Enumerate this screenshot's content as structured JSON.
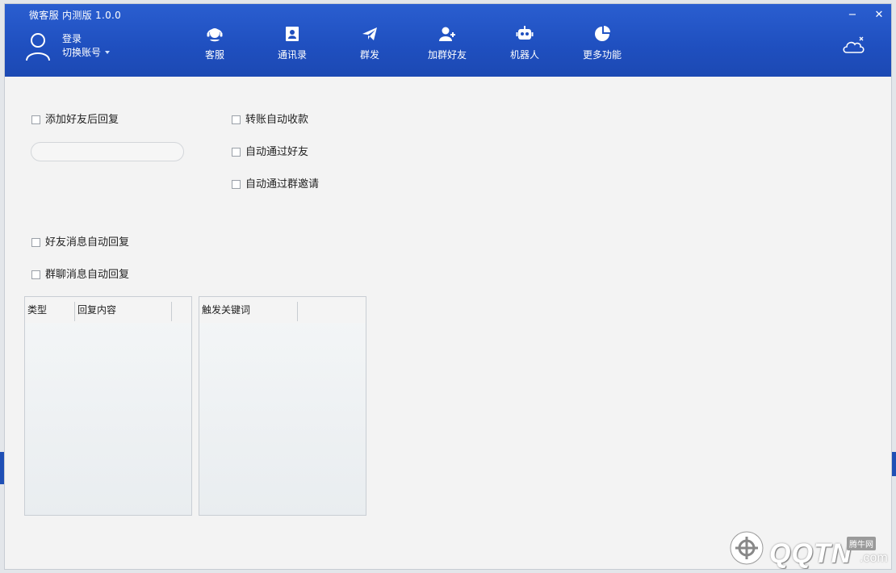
{
  "window": {
    "title": "微客服  内测版 1.0.0",
    "minimize_glyph": "−",
    "close_glyph": "✕"
  },
  "user": {
    "login_label": "登录",
    "switch_account_label": "切换账号"
  },
  "nav": {
    "items": [
      {
        "label": "客服",
        "icon": "headset-icon"
      },
      {
        "label": "通讯录",
        "icon": "contacts-icon"
      },
      {
        "label": "群发",
        "icon": "send-icon"
      },
      {
        "label": "加群好友",
        "icon": "add-friend-icon"
      },
      {
        "label": "机器人",
        "icon": "robot-icon"
      },
      {
        "label": "更多功能",
        "icon": "pie-chart-icon"
      }
    ],
    "active": "机器人"
  },
  "robot": {
    "add_friend_reply": {
      "label": "添加好友后回复",
      "checked": false
    },
    "reply_input": {
      "value": ""
    },
    "auto_collect_transfer": {
      "label": "转账自动收款",
      "checked": false
    },
    "auto_accept_friend": {
      "label": "自动通过好友",
      "checked": false
    },
    "auto_accept_group_invite": {
      "label": "自动通过群邀请",
      "checked": false
    },
    "friend_msg_auto_reply": {
      "label": "好友消息自动回复",
      "checked": false
    },
    "group_msg_auto_reply": {
      "label": "群聊消息自动回复",
      "checked": false
    },
    "reply_table": {
      "columns": [
        "类型",
        "回复内容"
      ]
    },
    "keyword_table": {
      "columns": [
        "触发关键词"
      ]
    }
  },
  "watermark": {
    "text": "QQTN",
    "suffix": ".com",
    "tag": "腾牛网"
  },
  "colors": {
    "titlebar": "#1f4fbf",
    "content_bg": "#f3f3f3"
  }
}
